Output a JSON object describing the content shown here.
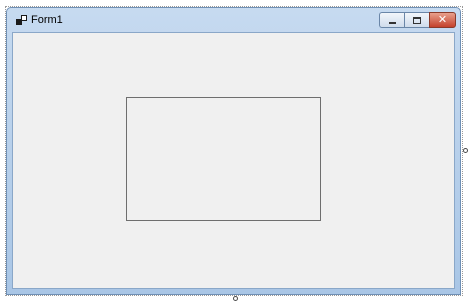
{
  "window": {
    "title": "Form1",
    "icon": "app-form-icon",
    "close_glyph": "✕"
  },
  "colors": {
    "frame": "#a9c6e6",
    "client_background": "#f0f0f0",
    "close_button": "#c4412c"
  }
}
